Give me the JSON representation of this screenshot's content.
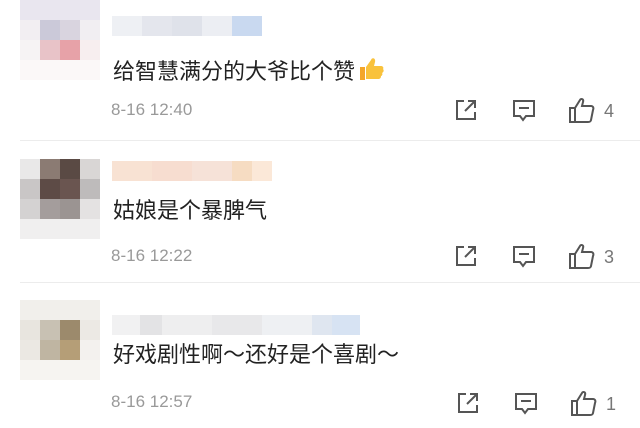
{
  "comments": [
    {
      "text": "给智慧满分的大爷比个赞",
      "emoji": "thumbs-up-emoji",
      "time": "8-16 12:40",
      "likes": "4"
    },
    {
      "text": "姑娘是个暴脾气",
      "time": "8-16 12:22",
      "likes": "3"
    },
    {
      "text": "好戏剧性啊～还好是个喜剧～",
      "time": "8-16 12:57",
      "likes": "1"
    }
  ],
  "icons": {
    "share": "share-icon",
    "reply": "reply-icon",
    "like": "thumbs-up-icon"
  },
  "colors": {
    "text": "#222222",
    "meta": "#999999",
    "icon": "#555555",
    "divider": "#ececec"
  }
}
